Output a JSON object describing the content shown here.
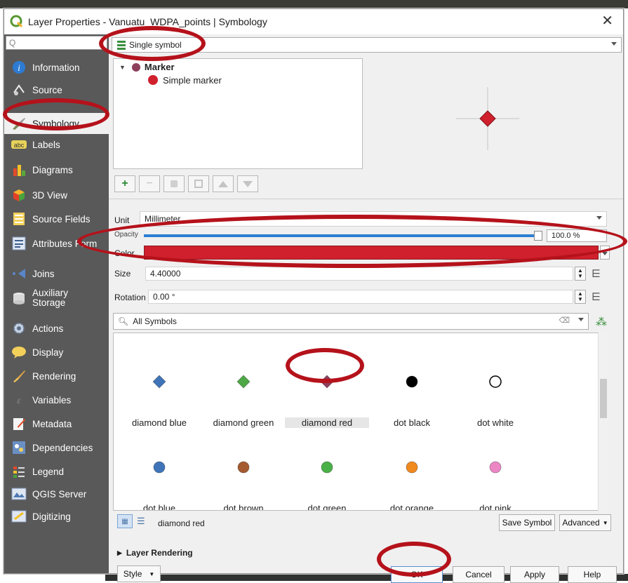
{
  "window": {
    "title": "Layer Properties - Vanuatu_WDPA_points | Symbology"
  },
  "sidebar": {
    "search_placeholder": "Q",
    "items": [
      {
        "label": "Information"
      },
      {
        "label": "Source"
      },
      {
        "label": "Symbology"
      },
      {
        "label": "Labels"
      },
      {
        "label": "Diagrams"
      },
      {
        "label": "3D View"
      },
      {
        "label": "Source Fields"
      },
      {
        "label": "Attributes Form"
      },
      {
        "label": "Joins"
      },
      {
        "label": "Auxiliary Storage"
      },
      {
        "label": "Actions"
      },
      {
        "label": "Display"
      },
      {
        "label": "Rendering"
      },
      {
        "label": "Variables"
      },
      {
        "label": "Metadata"
      },
      {
        "label": "Dependencies"
      },
      {
        "label": "Legend"
      },
      {
        "label": "QGIS Server"
      },
      {
        "label": "Digitizing"
      }
    ]
  },
  "renderer": {
    "type": "Single symbol"
  },
  "symbol_tree": {
    "root": "Marker",
    "child": "Simple marker"
  },
  "props": {
    "unit_label": "Unit",
    "unit_value": "Millimeter",
    "opacity_label": "Opacity",
    "opacity_value": "100.0 %",
    "color_label": "Color",
    "color_value": "#d0202d",
    "size_label": "Size",
    "size_value": "4.40000",
    "rotation_label": "Rotation",
    "rotation_value": "0.00 °"
  },
  "library": {
    "filter": "All Symbols",
    "symbols": [
      {
        "name": "diamond blue",
        "shape": "diamond",
        "color": "#3f74b8"
      },
      {
        "name": "diamond green",
        "shape": "diamond",
        "color": "#4ea845"
      },
      {
        "name": "diamond red",
        "shape": "diamond",
        "color": "#8e3f5e"
      },
      {
        "name": "dot  black",
        "shape": "dot",
        "color": "#000000"
      },
      {
        "name": "dot  white",
        "shape": "dot",
        "color": "#ffffff"
      },
      {
        "name": "dot blue",
        "shape": "dot",
        "color": "#3f74b8"
      },
      {
        "name": "dot brown",
        "shape": "dot",
        "color": "#a55a30"
      },
      {
        "name": "dot green",
        "shape": "dot",
        "color": "#4ab048"
      },
      {
        "name": "dot orange",
        "shape": "dot",
        "color": "#f0891e"
      },
      {
        "name": "dot pink",
        "shape": "dot",
        "color": "#ec86c4"
      }
    ],
    "selected": "diamond red",
    "save_symbol": "Save Symbol",
    "advanced": "Advanced"
  },
  "layer_rendering": "Layer Rendering",
  "footer": {
    "style": "Style",
    "ok": "OK",
    "cancel": "Cancel",
    "apply": "Apply",
    "help": "Help"
  },
  "colors": {
    "sidebar": "#595959",
    "annotation": "#b5121b",
    "selected_marker": "#d0202d"
  }
}
